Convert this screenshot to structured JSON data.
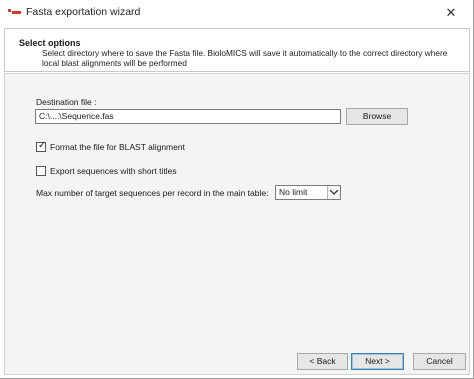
{
  "window": {
    "title": "Fasta exportation wizard",
    "close_glyph": "✕",
    "accent_color": "#d9382c"
  },
  "header": {
    "title": "Select options",
    "description": "Select directory where to save the Fasta file. BioloMICS will save it automatically to the correct directory where local blast alignments will be performed"
  },
  "form": {
    "destination_label": "Destination file :",
    "destination_value": "C:\\....\\Sequence.fas",
    "browse_label": "Browse",
    "format_blast": {
      "label": "Format the file for BLAST alignment",
      "checked": true
    },
    "short_titles": {
      "label": "Export sequences with short titles",
      "checked": false
    },
    "max_targets_label": "Max number of target sequences per record in the main table:",
    "max_targets_value": "No limit"
  },
  "footer": {
    "back_label": "< Back",
    "next_label": "Next >",
    "cancel_label": "Cancel"
  }
}
